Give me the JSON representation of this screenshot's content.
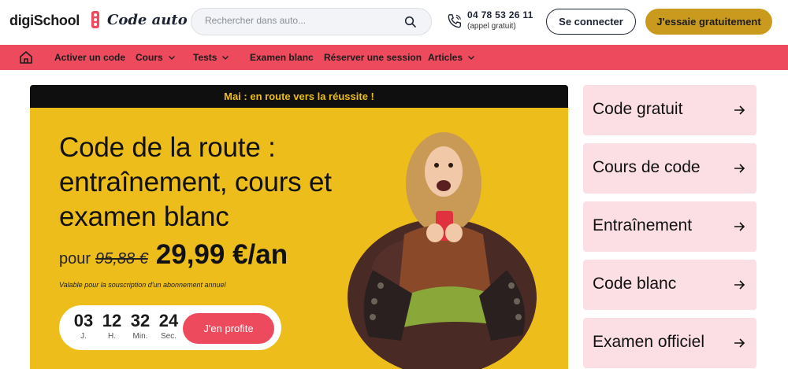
{
  "header": {
    "logo": "digiSchool",
    "brand": "Code auto",
    "search_placeholder": "Rechercher dans auto...",
    "phone_number": "04 78 53 26 11",
    "phone_note": "(appel gratuit)",
    "login_label": "Se connecter",
    "try_label": "J'essaie gratuitement"
  },
  "nav": {
    "items": [
      {
        "label": "Activer un code"
      },
      {
        "label": "Cours"
      },
      {
        "label": "Tests"
      },
      {
        "label": "Examen blanc"
      },
      {
        "label": "Réserver une session"
      },
      {
        "label": "Articles"
      }
    ]
  },
  "hero": {
    "banner": "Mai : en route vers la réussite !",
    "title": "Code de la route : entraînement, cours et examen blanc",
    "price_prefix": "pour",
    "price_old": "95,88 €",
    "price_new": "29,99 €/an",
    "price_note": "Valable pour la souscription d'un abonnement annuel",
    "countdown": [
      {
        "value": "03",
        "unit": "J."
      },
      {
        "value": "12",
        "unit": "H."
      },
      {
        "value": "32",
        "unit": "Min."
      },
      {
        "value": "24",
        "unit": "Sec."
      }
    ],
    "cta_label": "J'en profite"
  },
  "sidebar": {
    "cards": [
      {
        "label": "Code gratuit"
      },
      {
        "label": "Cours de code"
      },
      {
        "label": "Entraînement"
      },
      {
        "label": "Code blanc"
      },
      {
        "label": "Examen officiel"
      }
    ]
  },
  "colors": {
    "accent_red": "#ee4a5e",
    "accent_gold": "#c99a1e",
    "hero_yellow": "#ecbd1b",
    "card_pink": "#fbdfe4"
  }
}
